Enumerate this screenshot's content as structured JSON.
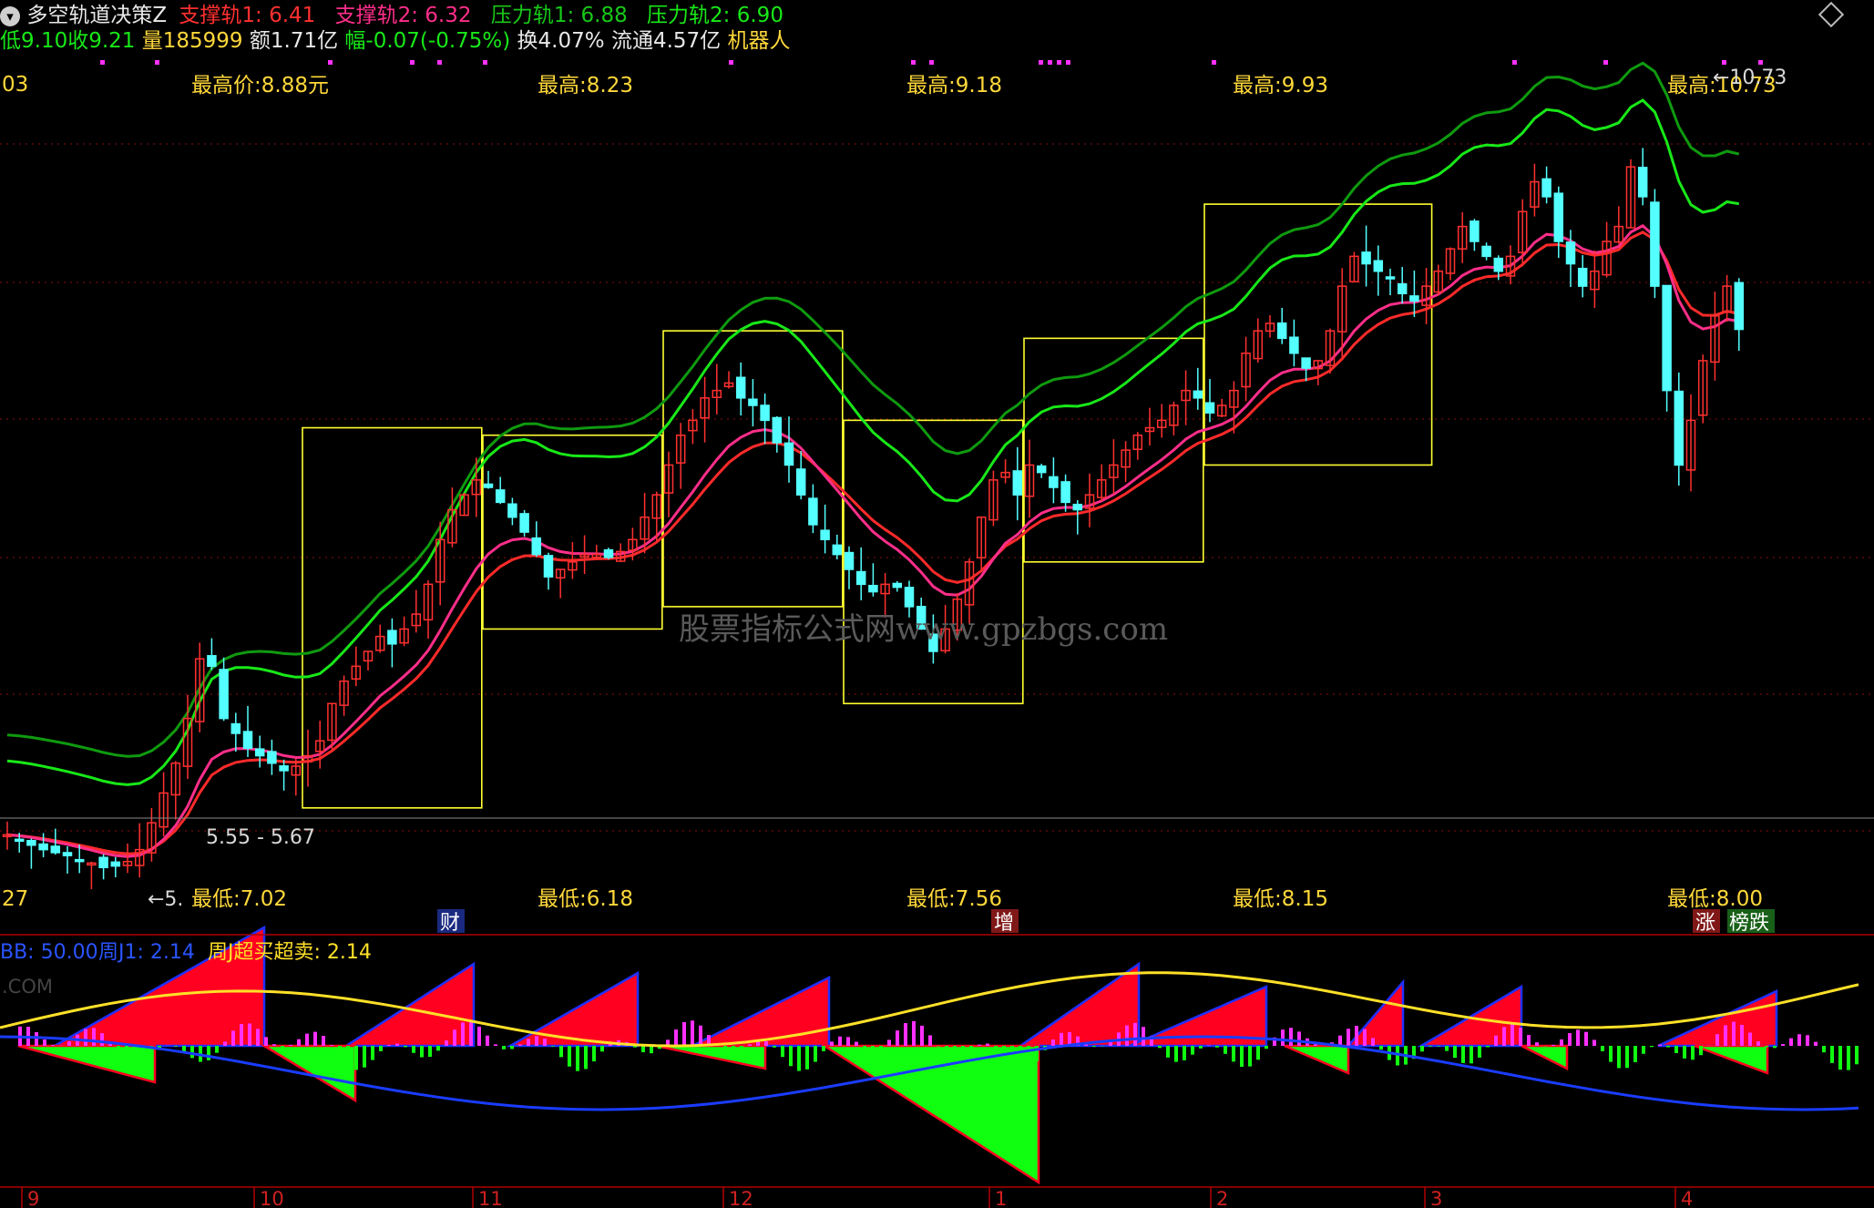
{
  "header": {
    "title": "多空轨道决策Z",
    "support1": "支撑轨1: 6.41",
    "support2": "支撑轨2: 6.32",
    "pressure1": "压力轨1: 6.88",
    "pressure2": "压力轨2: 6.90",
    "low": "低9.10",
    "close": "收9.21",
    "volume": "量185999",
    "amount": "额1.71亿",
    "change": "幅-0.07(-0.75%)",
    "turnover": "换4.07%",
    "float": "流通4.57亿",
    "robot": "机器人",
    "diamond_icon": "diamond-icon"
  },
  "main_labels": {
    "left_top": "03",
    "left_bottom": "27",
    "highs": [
      "最高价:8.88元",
      "最高:8.23",
      "最高:9.18",
      "最高:9.93",
      "最高:10.73"
    ],
    "lows": [
      "最低:7.02",
      "最低:6.18",
      "最低:7.56",
      "最低:8.15",
      "最低:8.00"
    ],
    "peak_marker": "←10.73",
    "range_line": "5.55 - 5.67",
    "low_marker": "←5.",
    "watermark": "股票指标公式网www.gpzbgs.com",
    "badges": [
      "财",
      "增",
      "涨",
      "榜跌"
    ]
  },
  "sub_header": {
    "bb": "BB: 50.00",
    "j1": "周J1: 2.14",
    "j": "周J超买超卖: 2.14",
    "com": ".COM"
  },
  "x_axis": {
    "months": [
      "9",
      "10",
      "11",
      "12",
      "1",
      "2",
      "3",
      "4"
    ]
  },
  "colors": {
    "up": "#ff3030",
    "down": "#54ffff",
    "red_band": "#ff2a2a",
    "pink_band": "#ff2e8a",
    "green_fast": "#18e818",
    "green_slow": "#0f9a0f",
    "yellow_box": "#ffff30",
    "osc_red": "#ff0020",
    "osc_green": "#10ff10",
    "osc_yellow": "#ffe028",
    "osc_blue": "#1a3cff",
    "magenta": "#ff30ff"
  },
  "chart_data": [
    {
      "type": "candlestick",
      "title": "多空轨道决策Z",
      "x": "trading days (Sep to Apr)",
      "closes": [
        5.82,
        5.78,
        5.75,
        5.72,
        5.7,
        5.68,
        5.65,
        5.63,
        5.6,
        5.61,
        5.64,
        5.72,
        5.9,
        6.1,
        6.3,
        6.6,
        7.0,
        6.95,
        6.6,
        6.5,
        6.4,
        6.35,
        6.3,
        6.25,
        6.28,
        6.35,
        6.45,
        6.7,
        6.85,
        6.95,
        7.05,
        7.15,
        7.1,
        7.2,
        7.3,
        7.5,
        7.8,
        8.0,
        8.1,
        8.2,
        8.15,
        8.05,
        7.95,
        7.85,
        7.7,
        7.55,
        7.6,
        7.65,
        7.7,
        7.7,
        7.68,
        7.72,
        7.8,
        7.95,
        8.1,
        8.3,
        8.5,
        8.6,
        8.75,
        8.8,
        8.85,
        8.75,
        8.7,
        8.6,
        8.45,
        8.3,
        8.1,
        7.9,
        7.8,
        7.7,
        7.6,
        7.5,
        7.45,
        7.5,
        7.48,
        7.35,
        7.2,
        7.05,
        7.2,
        7.4,
        7.65,
        7.95,
        8.2,
        8.25,
        8.1,
        8.3,
        8.25,
        8.15,
        8.05,
        8.0,
        8.1,
        8.2,
        8.3,
        8.4,
        8.5,
        8.55,
        8.6,
        8.7,
        8.8,
        8.75,
        8.65,
        8.7,
        8.8,
        9.05,
        9.2,
        9.25,
        9.15,
        9.05,
        8.95,
        9.0,
        9.2,
        9.5,
        9.7,
        9.65,
        9.6,
        9.55,
        9.45,
        9.4,
        9.5,
        9.6,
        9.75,
        9.9,
        9.8,
        9.7,
        9.6,
        9.7,
        10.0,
        10.2,
        10.1,
        9.8,
        9.65,
        9.5,
        9.6,
        9.8,
        9.9,
        10.3,
        10.1,
        9.5,
        8.8,
        8.3,
        8.6,
        9.0,
        9.3,
        9.5,
        9.21
      ],
      "high_labels": [
        8.88,
        8.23,
        9.18,
        9.93,
        10.73
      ],
      "low_labels": [
        7.02,
        6.18,
        7.56,
        8.15,
        8.0
      ],
      "series": [
        {
          "name": "支撑轨1",
          "last": 6.41
        },
        {
          "name": "支撑轨2",
          "last": 6.32
        },
        {
          "name": "压力轨1",
          "last": 6.88
        },
        {
          "name": "压力轨2",
          "last": 6.9
        }
      ],
      "ylim": [
        5.4,
        10.9
      ]
    },
    {
      "type": "bar",
      "title": "周J超买超卖",
      "series": [
        {
          "name": "BB",
          "last": 50.0
        },
        {
          "name": "周J1",
          "last": 2.14
        },
        {
          "name": "周J超买超卖",
          "last": 2.14
        }
      ]
    }
  ]
}
